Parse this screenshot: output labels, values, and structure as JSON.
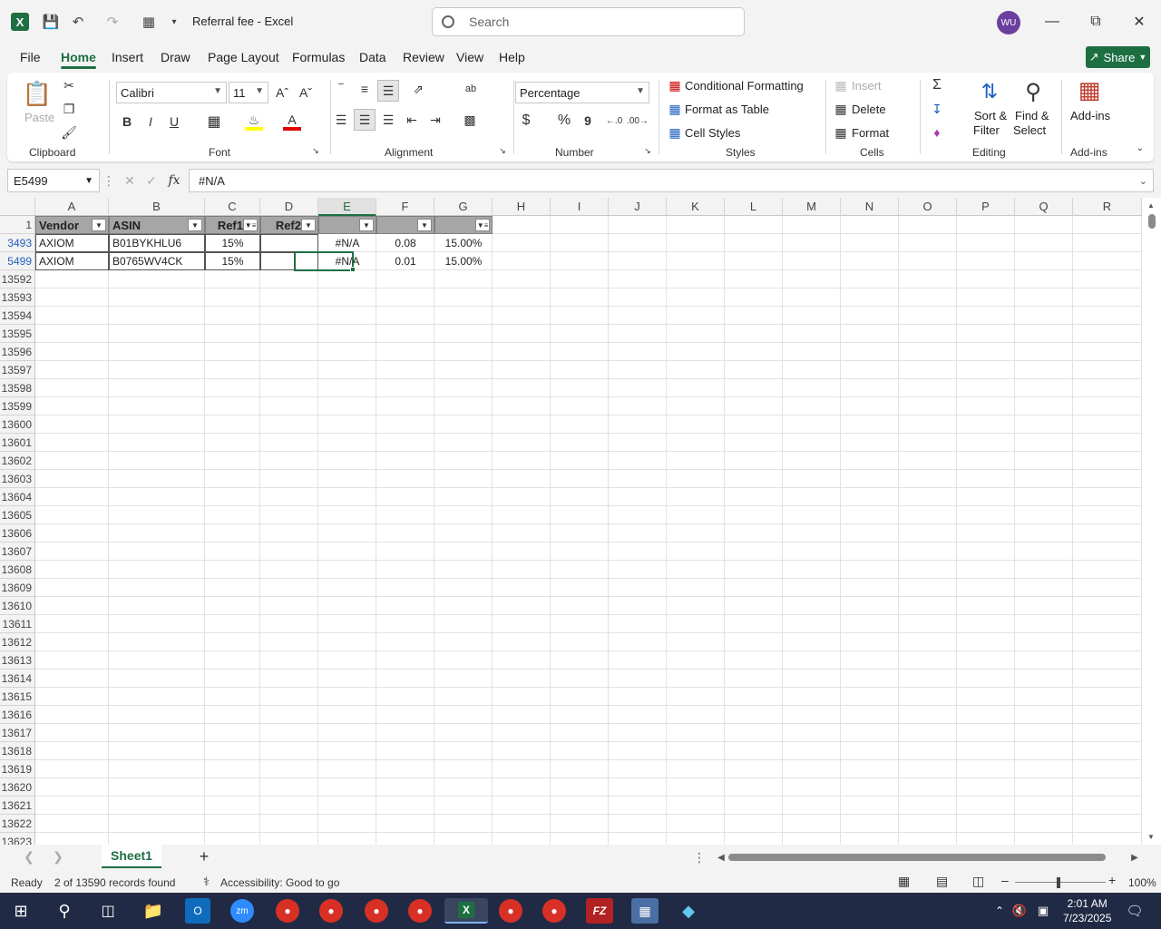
{
  "app": {
    "doc_title": "Referral fee  -  Excel",
    "search_placeholder": "Search",
    "user_initials": "WU"
  },
  "menu": {
    "tabs": [
      "File",
      "Home",
      "Insert",
      "Draw",
      "Page Layout",
      "Formulas",
      "Data",
      "Review",
      "View",
      "Help"
    ],
    "active_tab": "Home",
    "share_label": "Share"
  },
  "ribbon": {
    "clipboard": {
      "paste": "Paste",
      "label": "Clipboard"
    },
    "font": {
      "name": "Calibri",
      "size": "11",
      "label": "Font",
      "bold": "B",
      "italic": "I",
      "underline": "U"
    },
    "alignment": {
      "label": "Alignment"
    },
    "number": {
      "format": "Percentage",
      "label": "Number",
      "currency": "$",
      "percent": "%",
      "comma": "9"
    },
    "styles": {
      "conditional": "Conditional Formatting",
      "table": "Format as Table",
      "cell_styles": "Cell Styles",
      "label": "Styles"
    },
    "cells": {
      "insert": "Insert",
      "delete": "Delete",
      "format": "Format",
      "label": "Cells"
    },
    "editing": {
      "sort": "Sort &",
      "sort2": "Filter",
      "find": "Find &",
      "find2": "Select",
      "label": "Editing"
    },
    "addins": {
      "button": "Add-ins",
      "label": "Add-ins"
    }
  },
  "formula_bar": {
    "cell_ref": "E5499",
    "fx": "fx",
    "value": "#N/A"
  },
  "grid": {
    "columns": [
      "A",
      "B",
      "C",
      "D",
      "E",
      "F",
      "G",
      "H",
      "I",
      "J",
      "K",
      "L",
      "M",
      "N",
      "O",
      "P",
      "Q",
      "R"
    ],
    "selected_column": "E",
    "header_row": {
      "row": "1",
      "A": "Vendor",
      "B": "ASIN",
      "C": "Ref1",
      "D": "Ref2",
      "E": "",
      "F": "",
      "G": ""
    },
    "rows": [
      {
        "row": "3493",
        "A": "AXIOM",
        "B": "B01BYKHLU6",
        "C": "15%",
        "D": "",
        "E": "#N/A",
        "F": "0.08",
        "G": "15.00%"
      },
      {
        "row": "5499",
        "A": "AXIOM",
        "B": "B0765WV4CK",
        "C": "15%",
        "D": "",
        "E": "#N/A",
        "F": "0.01",
        "G": "15.00%"
      }
    ],
    "empty_rows": [
      "13592",
      "13593",
      "13594",
      "13595",
      "13596",
      "13597",
      "13598",
      "13599",
      "13600",
      "13601",
      "13602",
      "13603",
      "13604",
      "13605",
      "13606",
      "13607",
      "13608",
      "13609",
      "13610",
      "13611",
      "13612",
      "13613",
      "13614",
      "13615",
      "13616",
      "13617",
      "13618",
      "13619",
      "13620",
      "13621",
      "13622",
      "13623"
    ]
  },
  "sheets": {
    "tabs": [
      "Sheet1"
    ],
    "active": "Sheet1",
    "add": "+"
  },
  "status": {
    "ready": "Ready",
    "records": "2 of 13590 records found",
    "accessibility": "Accessibility: Good to go",
    "zoom": "100%"
  },
  "taskbar": {
    "time": "2:01 AM",
    "date": "7/23/2025"
  },
  "colors": {
    "excel_green": "#1d6f42",
    "header_fill": "#a6a6a6",
    "taskbar": "#202a44"
  }
}
